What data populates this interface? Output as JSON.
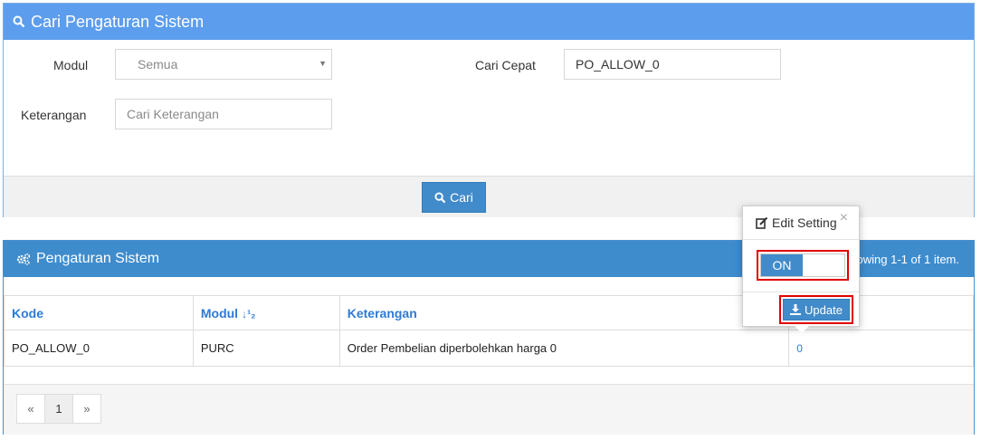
{
  "search_panel": {
    "title": "Cari Pengaturan Sistem",
    "modul_label": "Modul",
    "modul_value": "Semua",
    "cari_cepat_label": "Cari Cepat",
    "cari_cepat_value": "PO_ALLOW_0",
    "keterangan_label": "Keterangan",
    "keterangan_placeholder": "Cari Keterangan",
    "search_button": "Cari"
  },
  "result_panel": {
    "title": "Pengaturan Sistem",
    "summary": "owing 1-1 of 1 item.",
    "columns": [
      "Kode",
      "Modul",
      "Keterangan"
    ],
    "rows": [
      {
        "kode": "PO_ALLOW_0",
        "modul": "PURC",
        "keterangan": "Order Pembelian diperbolehkan harga 0",
        "value": "0"
      }
    ],
    "pager": {
      "prev": "«",
      "page": "1",
      "next": "»"
    }
  },
  "popover": {
    "title": "Edit Setting",
    "close": "×",
    "toggle_label": "ON",
    "update_button": "Update"
  },
  "colors": {
    "search_header": "#5c9ded",
    "result_header": "#3f8ccd",
    "button_blue": "#428bca",
    "highlight_red": "#e00000"
  }
}
